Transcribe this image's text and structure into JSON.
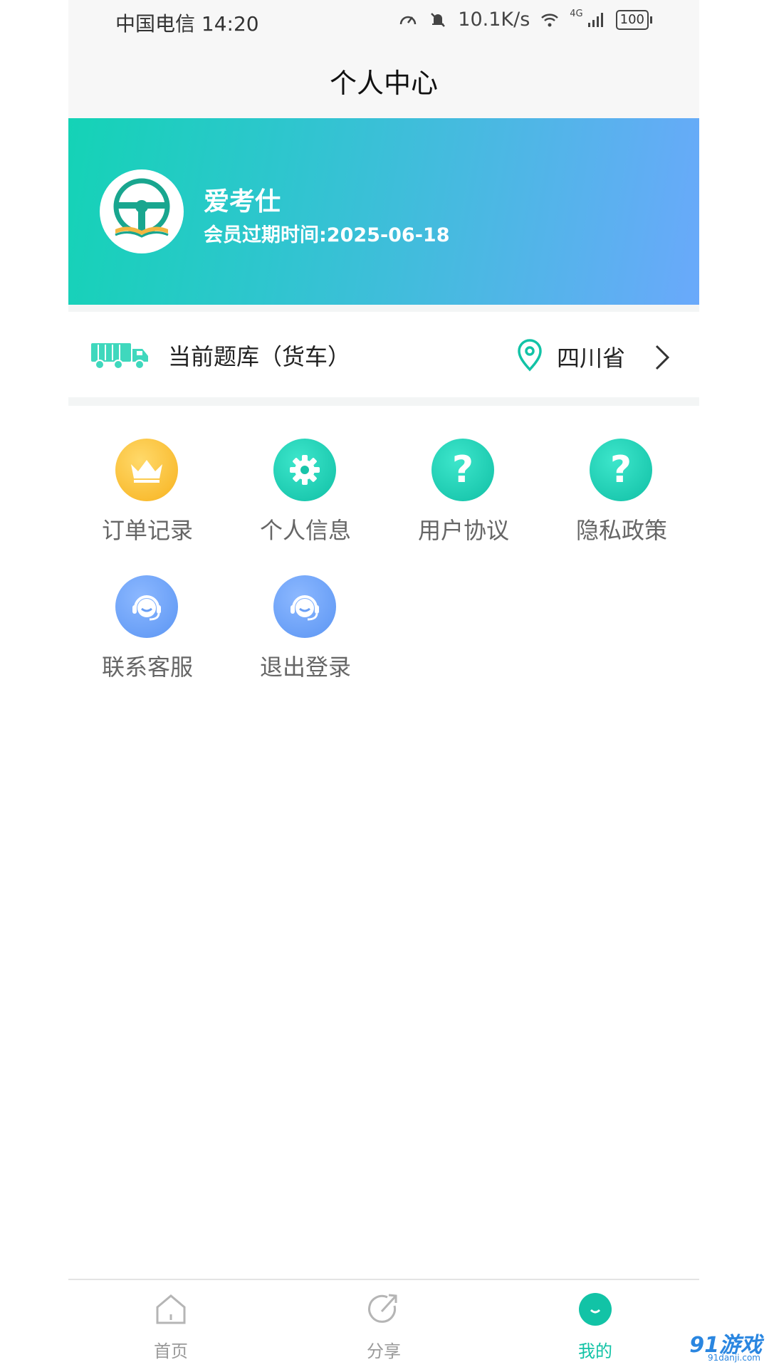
{
  "status_bar": {
    "carrier": "中国电信",
    "time": "14:20",
    "net_speed": "10.1K/s",
    "network": "4G",
    "battery": "100"
  },
  "header": {
    "title": "个人中心"
  },
  "profile": {
    "name": "爱考仕",
    "expiry": "会员过期时间:2025-06-18"
  },
  "bank": {
    "label": "当前题库（货车）",
    "province": "四川省"
  },
  "menu": [
    {
      "label": "订单记录",
      "icon": "crown-icon",
      "color": "#f7b21e"
    },
    {
      "label": "个人信息",
      "icon": "gear-icon",
      "color": "#10bfa5"
    },
    {
      "label": "用户协议",
      "icon": "question-icon",
      "color": "#10bfa5"
    },
    {
      "label": "隐私政策",
      "icon": "question-icon",
      "color": "#10bfa5"
    },
    {
      "label": "联系客服",
      "icon": "headset-icon",
      "color": "#5b95f3"
    },
    {
      "label": "退出登录",
      "icon": "headset-icon",
      "color": "#5b95f3"
    }
  ],
  "tabs": [
    {
      "label": "首页",
      "icon": "home-icon"
    },
    {
      "label": "分享",
      "icon": "share-icon"
    },
    {
      "label": "我的",
      "icon": "profile-icon",
      "active": true
    }
  ],
  "accent_color": "#12c3a6",
  "watermark": {
    "brand": "91游戏",
    "url": "91danji.com"
  }
}
